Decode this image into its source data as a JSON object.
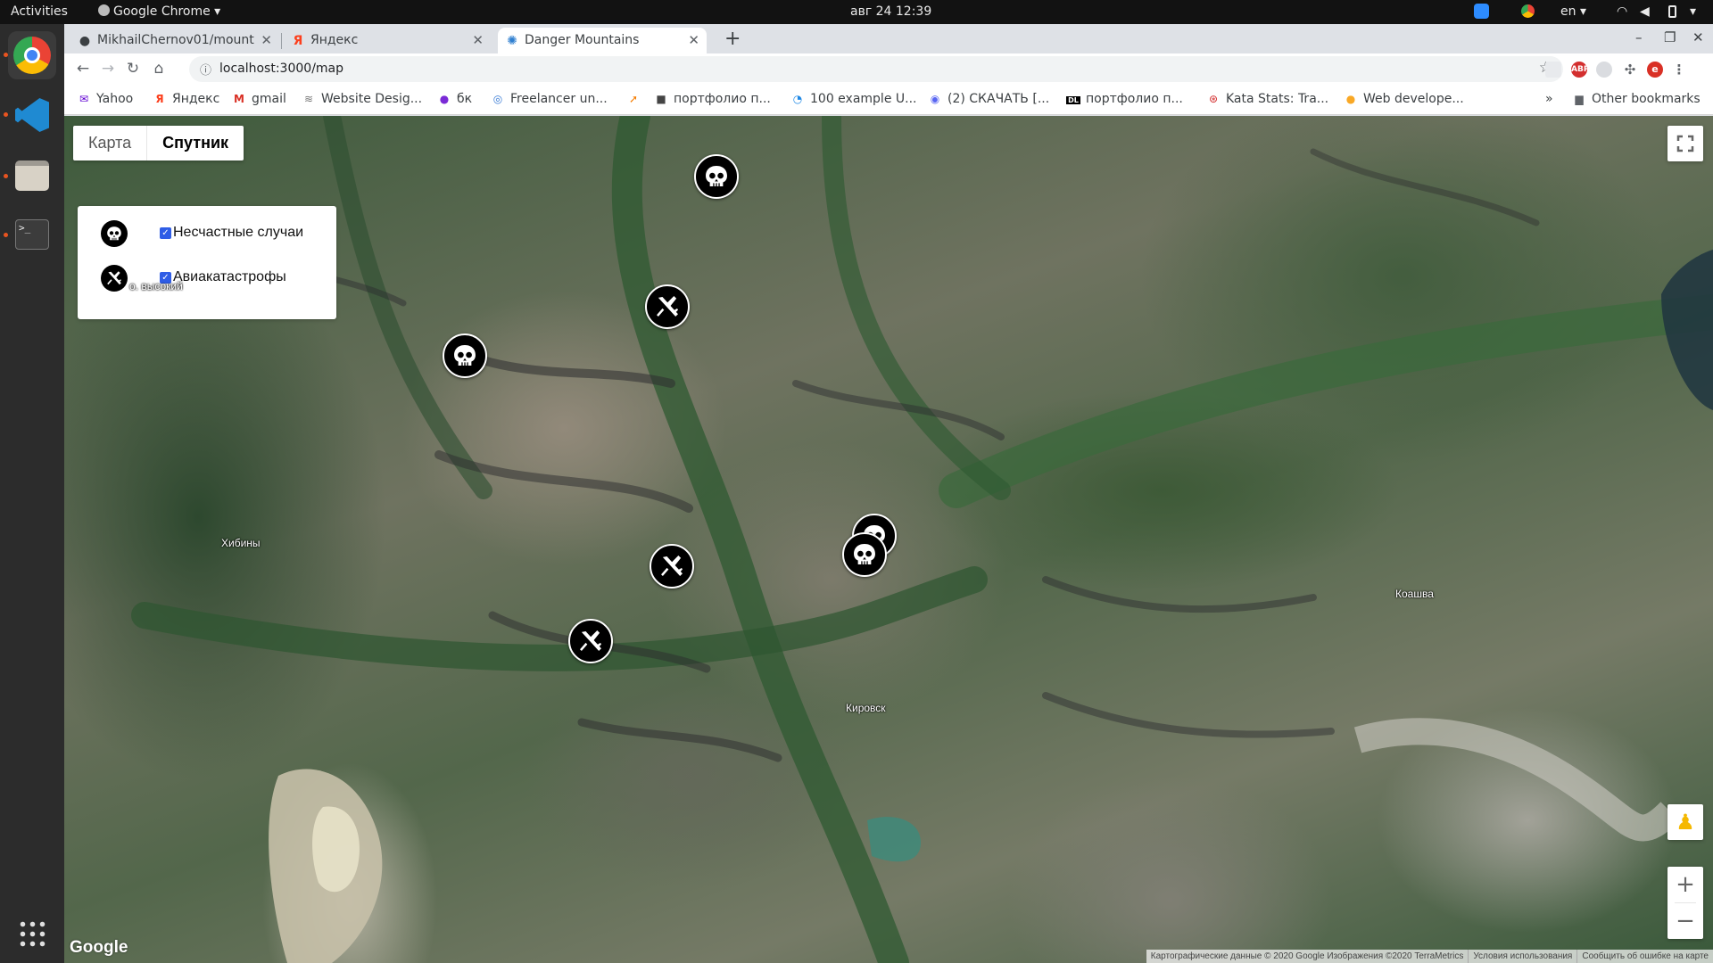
{
  "system": {
    "activities": "Activities",
    "app_menu": "Google Chrome",
    "clock": "авг 24  12:39",
    "lang": "en"
  },
  "tabs": [
    {
      "title": "MikhailChernov01/mount",
      "icon": "github-icon"
    },
    {
      "title": "Яндекс",
      "icon": "yandex-icon"
    },
    {
      "title": "Danger Mountains",
      "icon": "react-icon"
    }
  ],
  "address": {
    "url": "localhost:3000/map"
  },
  "bookmarks": [
    {
      "label": "Yahoo",
      "icon": "mail-icon"
    },
    {
      "label": "Яндекс",
      "icon": "yandex-icon"
    },
    {
      "label": "gmail",
      "icon": "gmail-icon"
    },
    {
      "label": "Website Desig...",
      "icon": "link-icon"
    },
    {
      "label": "бк",
      "icon": "bk-icon"
    },
    {
      "label": "Freelancer un...",
      "icon": "globe-icon"
    },
    {
      "label": "",
      "icon": "arrow-icon"
    },
    {
      "label": "портфолио п...",
      "icon": "cube-icon"
    },
    {
      "label": "100 example U...",
      "icon": "ui-icon"
    },
    {
      "label": "(2) СКАЧАТЬ [...",
      "icon": "discord-icon"
    },
    {
      "label": "портфолио п...",
      "icon": "dl-icon"
    },
    {
      "label": "Kata Stats: Tra...",
      "icon": "codewars-icon"
    },
    {
      "label": "Web develope...",
      "icon": "bulb-icon"
    }
  ],
  "bookmarks_more": "»",
  "bookmarks_other": "Other bookmarks",
  "map": {
    "type_buttons": {
      "map": "Карта",
      "satellite": "Спутник",
      "selected": "satellite"
    },
    "legend": [
      {
        "icon": "skull-icon",
        "label": "Несчастные случаи",
        "checked": true
      },
      {
        "icon": "plane-crash-icon",
        "label": "Авиакатастрофы",
        "checked": true
      }
    ],
    "place_labels": [
      "о. высокий",
      "Хибины",
      "Коашва",
      "Кировск"
    ],
    "markers": [
      {
        "type": "accident",
        "icon": "skull-icon"
      },
      {
        "type": "plane",
        "icon": "plane-crash-icon"
      },
      {
        "type": "accident",
        "icon": "skull-icon"
      },
      {
        "type": "accident",
        "icon": "skull-icon"
      },
      {
        "type": "accident",
        "icon": "skull-icon"
      },
      {
        "type": "plane",
        "icon": "plane-crash-icon"
      },
      {
        "type": "plane",
        "icon": "plane-crash-icon"
      }
    ],
    "logo": "Google",
    "attribution": [
      "Картографические данные © 2020 Google Изображения ©2020 TerraMetrics",
      "Условия использования",
      "Сообщить об ошибке на карте"
    ],
    "zoom_in": "+",
    "zoom_out": "−"
  }
}
